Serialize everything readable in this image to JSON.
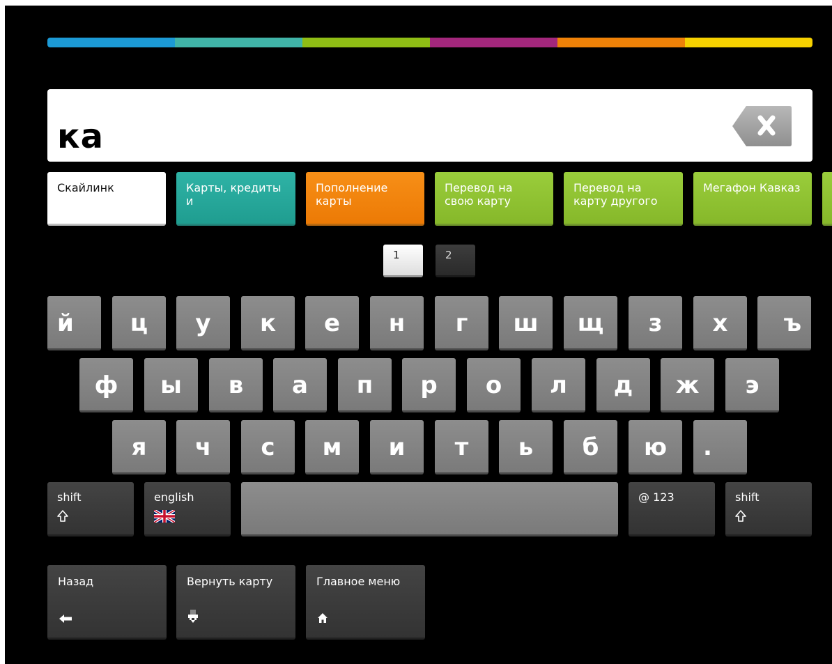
{
  "search": {
    "query": "ка"
  },
  "stripes": [
    "#1c9ad6",
    "#40b4a8",
    "#8fbd15",
    "#a3277c",
    "#ef8208",
    "#f6d100"
  ],
  "suggestions": [
    {
      "label": "Скайлинк",
      "color": "#ffffff"
    },
    {
      "label": "Карты, кредиты и",
      "color": "#27a79b"
    },
    {
      "label": "Пополнение карты",
      "color": "#f3810e"
    },
    {
      "label": "Перевод на свою карту",
      "color": "#8cc130"
    },
    {
      "label": "Перевод на карту другого",
      "color": "#8cc130"
    },
    {
      "label": "Мегафон Кавказ",
      "color": "#8cc130"
    }
  ],
  "pagination": [
    "1",
    "2"
  ],
  "keyboard": {
    "row1": [
      "й",
      "ц",
      "у",
      "к",
      "е",
      "н",
      "г",
      "ш",
      "щ",
      "з",
      "х",
      "ъ"
    ],
    "row2": [
      "ф",
      "ы",
      "в",
      "а",
      "п",
      "р",
      "о",
      "л",
      "д",
      "ж",
      "э"
    ],
    "row3": [
      "я",
      "ч",
      "с",
      "м",
      "и",
      "т",
      "ь",
      "б",
      "ю",
      "."
    ],
    "shift_left": "shift",
    "language": "english",
    "numeric": "@ 123",
    "shift_right": "shift"
  },
  "nav": {
    "back": "Назад",
    "return_card": "Вернуть карту",
    "main_menu": "Главное меню"
  },
  "icons": {
    "backspace": "backspace-icon",
    "shift": "shift-arrow-icon",
    "flag": "uk-flag-icon",
    "back": "left-arrow-icon",
    "card": "card-eject-icon",
    "home": "home-icon"
  }
}
